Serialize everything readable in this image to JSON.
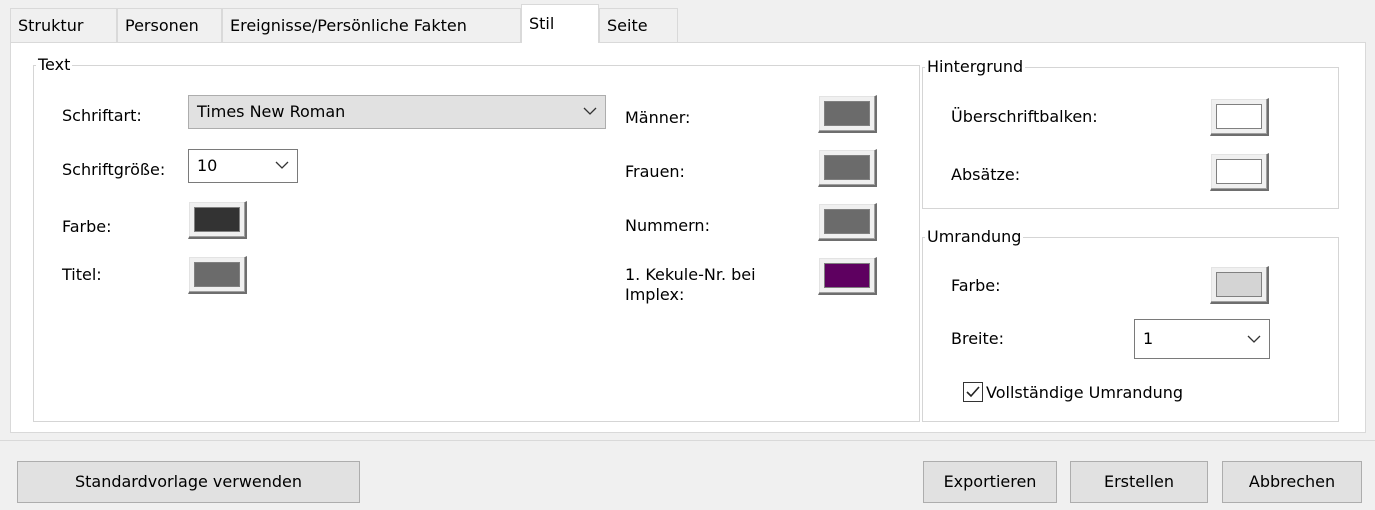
{
  "tabs": [
    {
      "label": "Struktur"
    },
    {
      "label": "Personen"
    },
    {
      "label": "Ereignisse/Persönliche Fakten"
    },
    {
      "label": "Stil"
    },
    {
      "label": "Seite"
    }
  ],
  "text_group": {
    "title": "Text",
    "font_label": "Schriftart:",
    "font_value": "Times New Roman",
    "size_label": "Schriftgröße:",
    "size_value": "10",
    "color_label": "Farbe:",
    "color_value": "#333333",
    "title_label": "Titel:",
    "title_color": "#6b6b6b"
  },
  "persons": {
    "men_label": "Männer:",
    "men_color": "#6b6b6b",
    "women_label": "Frauen:",
    "women_color": "#6b6b6b",
    "numbers_label": "Nummern:",
    "numbers_color": "#6b6b6b",
    "kekule_label_1": "1. Kekule-Nr. bei",
    "kekule_label_2": "Implex:",
    "kekule_color": "#5e0060"
  },
  "background_group": {
    "title": "Hintergrund",
    "header_label": "Überschriftbalken:",
    "header_color": "#ffffff",
    "paragraph_label": "Absätze:",
    "paragraph_color": "#ffffff"
  },
  "border_group": {
    "title": "Umrandung",
    "color_label": "Farbe:",
    "color_value": "#d4d4d4",
    "width_label": "Breite:",
    "width_value": "1",
    "full_border_label": "Vollständige Umrandung",
    "full_border_checked": true
  },
  "buttons": {
    "default_template": "Standardvorlage verwenden",
    "export": "Exportieren",
    "create": "Erstellen",
    "cancel": "Abbrechen"
  }
}
